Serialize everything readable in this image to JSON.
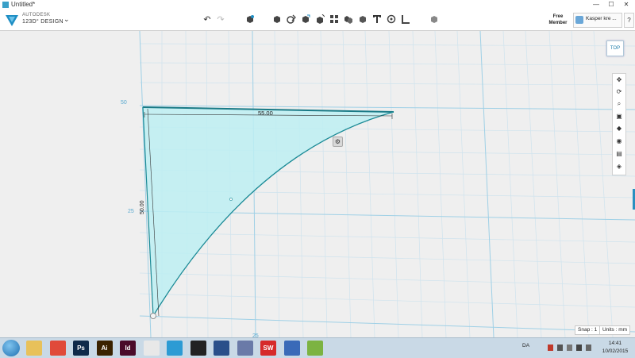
{
  "window": {
    "title": "Untitled*",
    "minimize": "—",
    "maximize": "☐",
    "close": "✕"
  },
  "brand": {
    "line1": "AUTODESK",
    "line2": "123D° DESIGN",
    "menu_chevron": "⌄"
  },
  "toolbar": {
    "undo": "↶",
    "redo": "↷",
    "tools": [
      "transform-icon",
      "primitives-icon",
      "sketch-icon",
      "construct-icon",
      "modify-icon",
      "pattern-icon",
      "group-icon",
      "combine-icon",
      "text-icon",
      "snap-icon",
      "measure-icon",
      "material-icon"
    ]
  },
  "member": {
    "line1": "Free",
    "line2": "Member"
  },
  "user": {
    "name": "Kasper kre ..."
  },
  "help": "?",
  "viewcube": {
    "label": "TOP"
  },
  "nav_buttons": [
    "pan-icon",
    "orbit-icon",
    "zoom-icon",
    "fit-icon",
    "view-icon",
    "visibility-icon",
    "layers-icon",
    "material-icon"
  ],
  "grid_labels": {
    "y_top": "50",
    "y_mid": "25",
    "x_mid": "25"
  },
  "dimensions": {
    "horizontal": "55.00",
    "vertical": "50.00"
  },
  "status": {
    "snap": "Snap : 1",
    "units": "Units : mm"
  },
  "taskbar": {
    "apps": [
      {
        "name": "explorer",
        "label": "",
        "color": "#e8c15a"
      },
      {
        "name": "chrome",
        "label": "",
        "color": "#e04a3a"
      },
      {
        "name": "photoshop",
        "label": "Ps",
        "color": "#0f2a4a"
      },
      {
        "name": "illustrator",
        "label": "Ai",
        "color": "#3a2200"
      },
      {
        "name": "indesign",
        "label": "Id",
        "color": "#4a0a2a"
      },
      {
        "name": "blender",
        "label": "",
        "color": "#e8e8e8"
      },
      {
        "name": "123d-design",
        "label": "",
        "color": "#2c9bd4"
      },
      {
        "name": "inkscape",
        "label": "",
        "color": "#222222"
      },
      {
        "name": "virtualbox",
        "label": "",
        "color": "#2a4f8a"
      },
      {
        "name": "app-box",
        "label": "",
        "color": "#6a7aa8"
      },
      {
        "name": "solidworks",
        "label": "SW",
        "color": "#d62a2a"
      },
      {
        "name": "settings",
        "label": "",
        "color": "#3a6ab8"
      },
      {
        "name": "notes",
        "label": "",
        "color": "#7cb342"
      }
    ],
    "language": "DA",
    "time": "14:41",
    "date": "10/02/2015"
  }
}
